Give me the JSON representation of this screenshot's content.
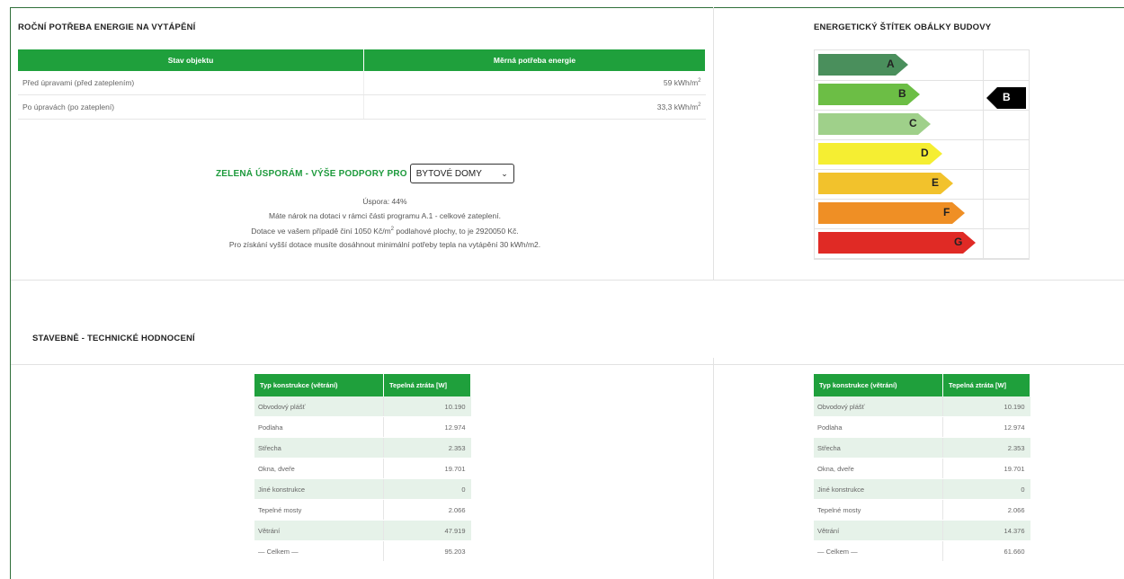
{
  "heating": {
    "title": "ROČNÍ POTŘEBA ENERGIE NA VYTÁPĚNÍ",
    "columns": [
      "Stav objektu",
      "Měrná potřeba energie"
    ],
    "rows": [
      {
        "label": "Před úpravami (před zateplením)",
        "value": "59 kWh/m",
        "sup": "2"
      },
      {
        "label": "Po úpravách (po zateplení)",
        "value": "33,3 kWh/m",
        "sup": "2"
      }
    ]
  },
  "support": {
    "label": "ZELENÁ ÚSPORÁM - VÝŠE PODPORY PRO",
    "selected": "BYTOVÉ DOMY",
    "saving": "Úspora: 44%",
    "line1": "Máte nárok na dotaci v rámci části programu A.1 - celkové zateplení.",
    "line2_a": "Dotace ve vašem případě činí 1050 Kč/m",
    "line2_sup": "2",
    "line2_b": " podlahové plochy, to je 2920050 Kč.",
    "line3": "Pro získání vyšší dotace musíte dosáhnout minimální potřeby tepla na vytápění 30 kWh/m2."
  },
  "energy_label": {
    "title": "ENERGETICKÝ ŠTÍTEK OBÁLKY BUDOVY",
    "classes": [
      {
        "letter": "A",
        "color": "#4a8f5c"
      },
      {
        "letter": "B",
        "color": "#6cbe45"
      },
      {
        "letter": "C",
        "color": "#9fd08a"
      },
      {
        "letter": "D",
        "color": "#f5ee32"
      },
      {
        "letter": "E",
        "color": "#f2c22c"
      },
      {
        "letter": "F",
        "color": "#ef8f25"
      },
      {
        "letter": "G",
        "color": "#e02a25"
      }
    ],
    "current": "B",
    "marker_color": "#000000"
  },
  "technical": {
    "title": "STAVEBNĚ - TECHNICKÉ HODNOCENÍ",
    "columns": [
      "Typ konstrukce (větrání)",
      "Tepelná ztráta [W]"
    ],
    "before": [
      {
        "label": "Obvodový plášť",
        "value": "10.190"
      },
      {
        "label": "Podlaha",
        "value": "12.974"
      },
      {
        "label": "Střecha",
        "value": "2.353"
      },
      {
        "label": "Okna, dveře",
        "value": "19.701"
      },
      {
        "label": "Jiné konstrukce",
        "value": "0"
      },
      {
        "label": "Tepelné mosty",
        "value": "2.066"
      },
      {
        "label": "Větrání",
        "value": "47.919"
      },
      {
        "label": "— Celkem —",
        "value": "95.203"
      }
    ],
    "after": [
      {
        "label": "Obvodový plášť",
        "value": "10.190"
      },
      {
        "label": "Podlaha",
        "value": "12.974"
      },
      {
        "label": "Střecha",
        "value": "2.353"
      },
      {
        "label": "Okna, dveře",
        "value": "19.701"
      },
      {
        "label": "Jiné konstrukce",
        "value": "0"
      },
      {
        "label": "Tepelné mosty",
        "value": "2.066"
      },
      {
        "label": "Větrání",
        "value": "14.376"
      },
      {
        "label": "— Celkem —",
        "value": "61.660"
      }
    ]
  },
  "colors": {
    "accent_green": "#1fa03c",
    "row_alt": "#e6f2e9",
    "frame": "#2f6f3a"
  }
}
